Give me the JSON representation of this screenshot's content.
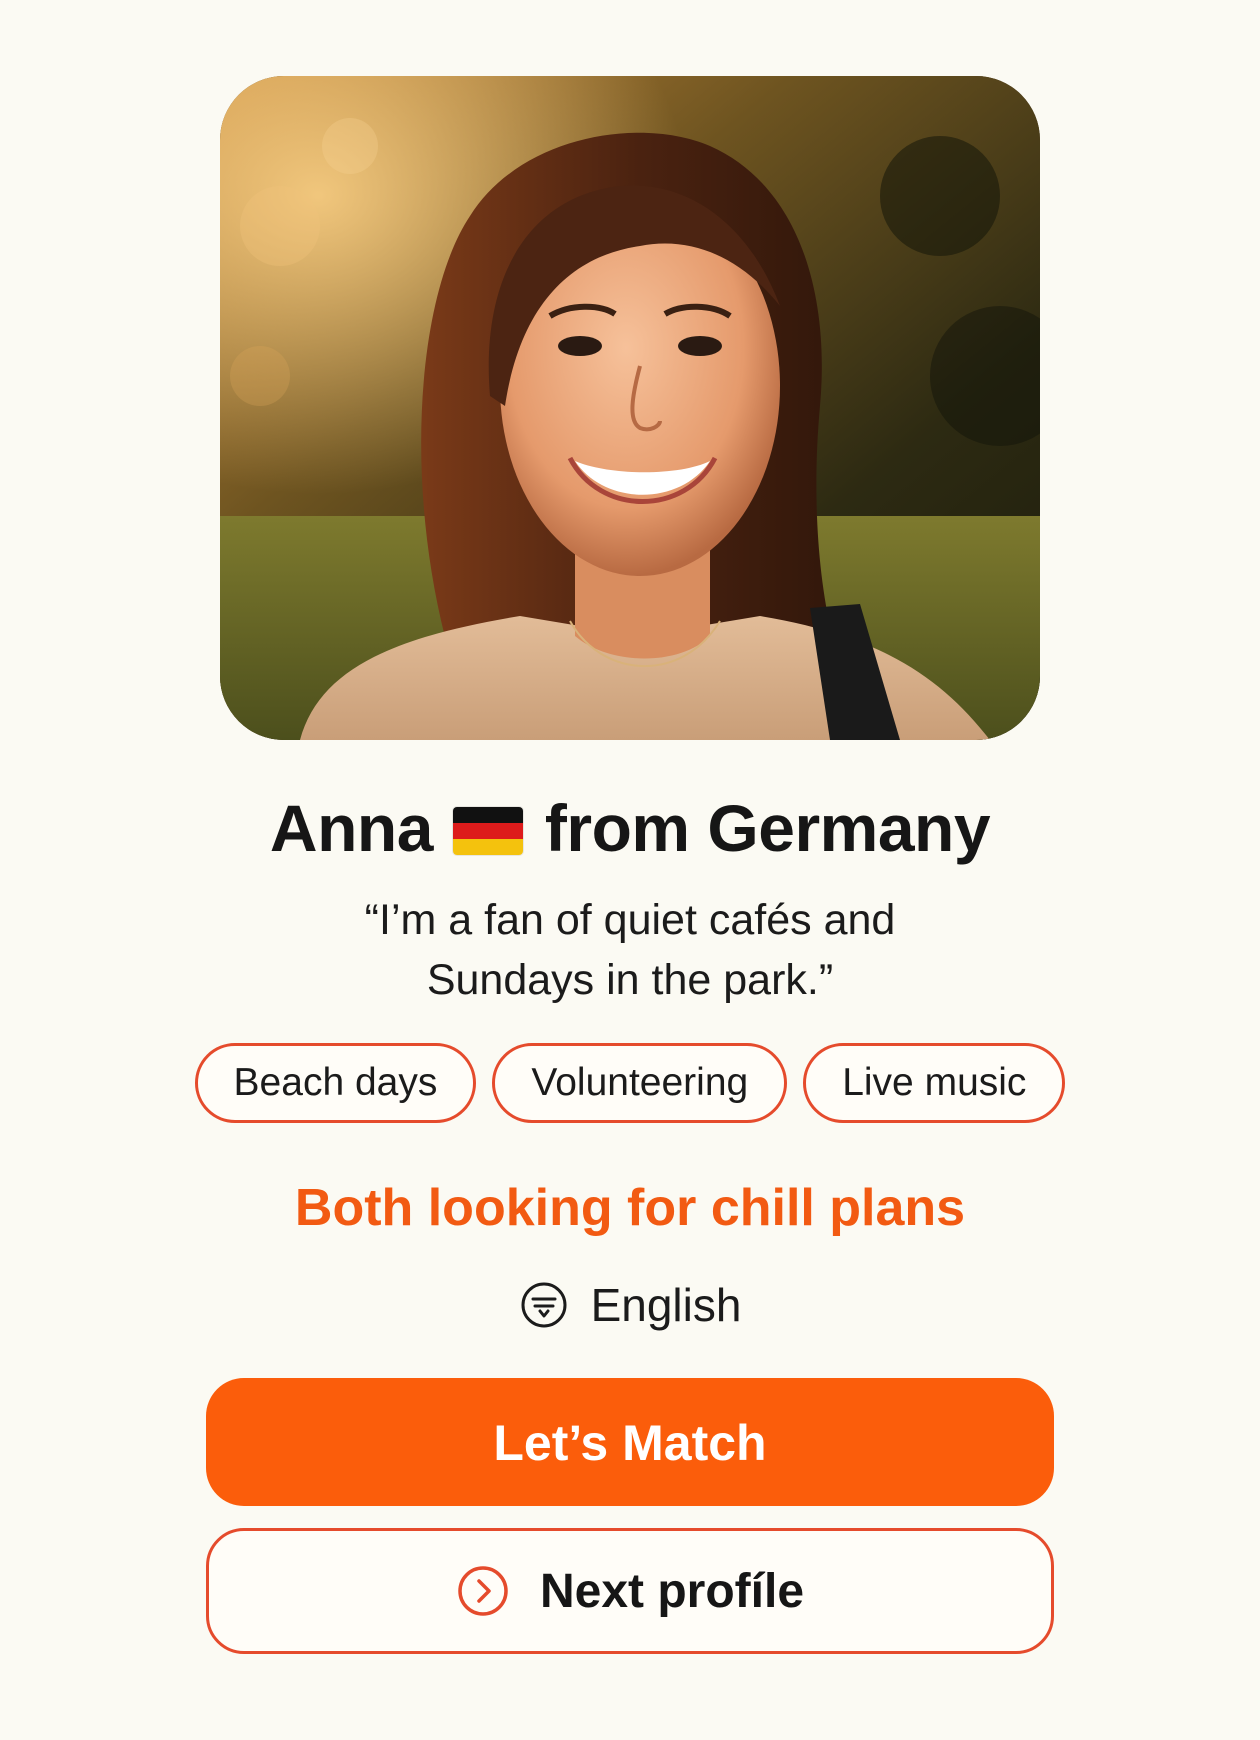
{
  "profile": {
    "name": "Anna",
    "title_suffix": "from Germany",
    "flag_icon": "germany-flag-icon",
    "quote_line1": "“I’m a fan of quiet cafés and",
    "quote_line2": "Sundays in the park.”",
    "tags": [
      "Beach days",
      "Volunteering",
      "Live music"
    ],
    "shared_interest": "Both looking for chill plans",
    "language": "English",
    "language_icon": "language-icon"
  },
  "actions": {
    "match_label": "Let’s Match",
    "next_label": "Next profíle",
    "next_icon": "chevron-right-circle-icon"
  },
  "colors": {
    "background": "#fbfaf3",
    "accent": "#fb5d0b",
    "accent_text": "#f25a12",
    "outline": "#e54b2c",
    "text": "#161616"
  }
}
